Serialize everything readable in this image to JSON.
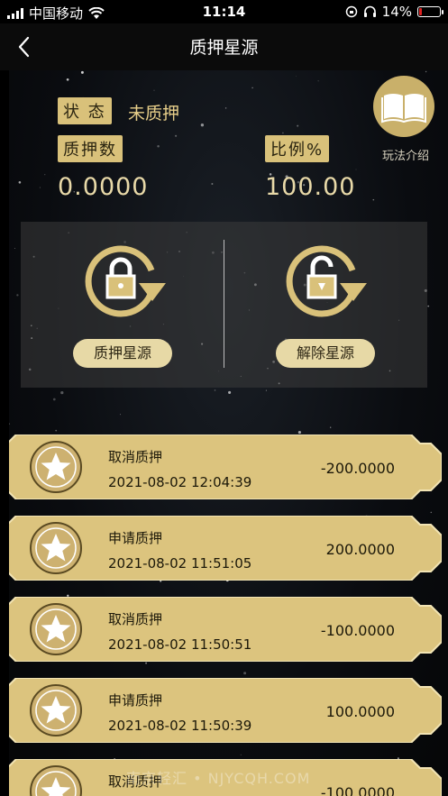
{
  "status_bar": {
    "carrier": "中国移动",
    "time": "11:14",
    "battery_percent": "14%",
    "battery_level": 0.14
  },
  "nav": {
    "title": "质押星源"
  },
  "summary": {
    "status_label": "状 态",
    "status_value": "未质押",
    "stake_label": "质押数",
    "stake_value": "0.0000",
    "ratio_label": "比例%",
    "ratio_value": "100.00",
    "guide_label": "玩法介绍"
  },
  "actions": {
    "stake_button": "质押星源",
    "unstake_button": "解除星源"
  },
  "records": [
    {
      "type": "取消质押",
      "time": "2021-08-02 12:04:39",
      "amount": "-200.0000"
    },
    {
      "type": "申请质押",
      "time": "2021-08-02 11:51:05",
      "amount": "200.0000"
    },
    {
      "type": "取消质押",
      "time": "2021-08-02 11:50:51",
      "amount": "-100.0000"
    },
    {
      "type": "申请质押",
      "time": "2021-08-02 11:50:39",
      "amount": "100.0000"
    },
    {
      "type": "取消质押",
      "time": "",
      "amount": "-100.0000"
    }
  ],
  "watermark": "南京轻汇 • NJYCQH.COM",
  "colors": {
    "gold": "#d9c17a",
    "gold_light": "#e8cf8a",
    "card_gold": "#dcc47e"
  }
}
